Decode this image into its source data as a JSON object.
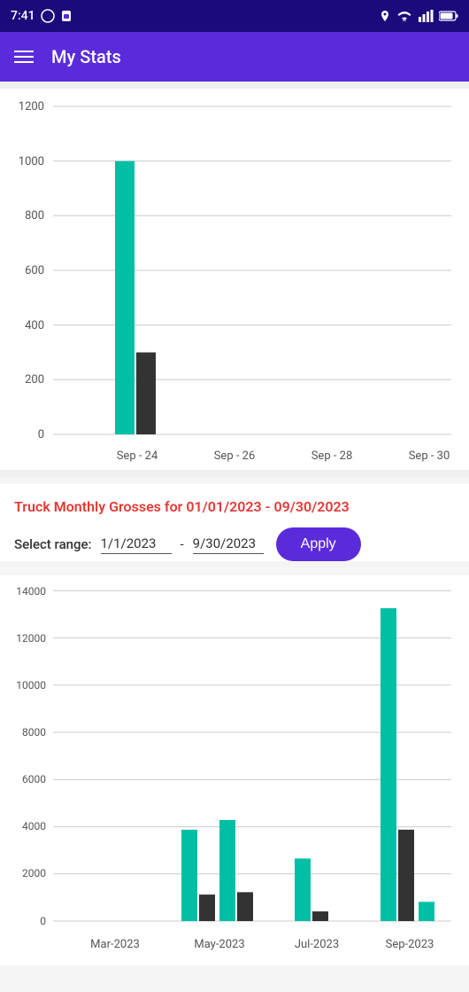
{
  "statusBar": {
    "time": "7:41",
    "icons": [
      "circle-icon",
      "sim-icon",
      "location-icon",
      "wifi-icon",
      "signal-icon",
      "battery-icon"
    ]
  },
  "appBar": {
    "title": "My Stats",
    "menuIcon": "hamburger-icon"
  },
  "topChart": {
    "yLabels": [
      "0",
      "200",
      "400",
      "600",
      "800",
      "1000",
      "1200"
    ],
    "xLabels": [
      "Sep - 24",
      "Sep - 26",
      "Sep - 28",
      "Sep - 30"
    ],
    "bars": [
      {
        "x": "Sep - 24",
        "teal": 1000,
        "dark": 300
      }
    ]
  },
  "monthlySection": {
    "titleStatic": "Truck Monthly Grosses for ",
    "dateRange": "01/01/2023 - 09/30/2023",
    "selectRangeLabel": "Select range:",
    "startDate": "1/1/2023",
    "endDate": "9/30/2023",
    "applyLabel": "Apply"
  },
  "bottomChart": {
    "yLabels": [
      "0",
      "2000",
      "4000",
      "6000",
      "8000",
      "10000",
      "12000",
      "14000"
    ],
    "xLabels": [
      "Mar-2023",
      "May-2023",
      "Jul-2023",
      "Sep-2023"
    ],
    "bars": [
      {
        "month": "Mar-2023",
        "teal": 0,
        "dark": 0
      },
      {
        "month": "May-2023",
        "teal": 3800,
        "dark": 1100
      },
      {
        "month": "May-2023b",
        "teal": 4200,
        "dark": 1200
      },
      {
        "month": "Jul-2023",
        "teal": 2600,
        "dark": 400
      },
      {
        "month": "Sep-2023",
        "teal": 13000,
        "dark": 3800
      },
      {
        "month": "Sep-2023b",
        "teal": 800,
        "dark": 0
      }
    ]
  }
}
